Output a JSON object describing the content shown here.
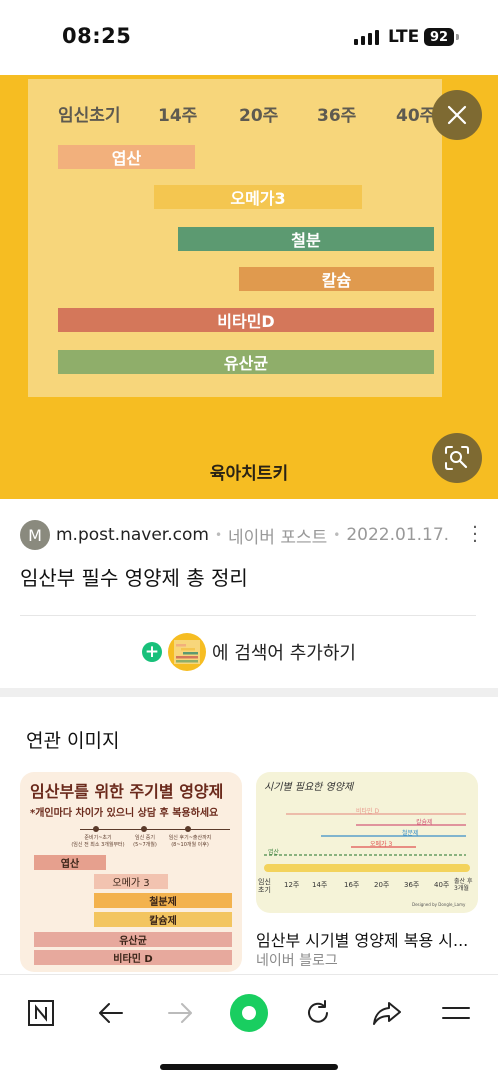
{
  "status_bar": {
    "time": "08:25",
    "network": "LTE",
    "battery": "92"
  },
  "hero": {
    "headers": [
      "임신초기",
      "14주",
      "20주",
      "36주",
      "40주"
    ],
    "bars": [
      {
        "label": "엽산",
        "color": "#f2b07c"
      },
      {
        "label": "오메가3",
        "color": "#f4c650"
      },
      {
        "label": "철분",
        "color": "#5c9a71"
      },
      {
        "label": "칼슘",
        "color": "#e09a4e"
      },
      {
        "label": "비타민D",
        "color": "#d4775a"
      },
      {
        "label": "유산균",
        "color": "#8fae6a"
      }
    ],
    "brand": "육아치트키"
  },
  "result": {
    "favicon_letter": "M",
    "domain": "m.post.naver.com",
    "service": "네이버 포스트",
    "date": "2022.01.17.",
    "title": "임산부 필수 영양제 총 정리",
    "add_search": "에 검색어 추가하기"
  },
  "related": {
    "heading": "연관 이미지",
    "card1": {
      "title": "임산부를 위한 주기별 영양제",
      "subtitle": "*개인마다 차이가 있으니 상담 후 복용하세요",
      "timeline": [
        {
          "label": "준비기~초기",
          "sub": "(임신 전 최소 3개월부터)"
        },
        {
          "label": "임신 중기",
          "sub": "(5~7개월)"
        },
        {
          "label": "임신 후기~출산까지",
          "sub": "(8~10개월 이후)"
        }
      ],
      "bars": [
        "엽산",
        "오메가 3",
        "철분제",
        "칼슘제",
        "유산균",
        "비타민 D"
      ]
    },
    "card2": {
      "title": "시기별 필요한 영양제",
      "lines": [
        "비타민 D",
        "칼슘제",
        "철분제",
        "오메가 3",
        "엽산"
      ],
      "axis": [
        "임신초기",
        "12주",
        "14주",
        "16주",
        "20주",
        "36주",
        "40주",
        "출산 후 3개월"
      ],
      "credit": "Designed by Dongle_Lamy",
      "caption": "임산부 시기별 영양제 복용 시...",
      "source": "네이버 블로그"
    }
  }
}
